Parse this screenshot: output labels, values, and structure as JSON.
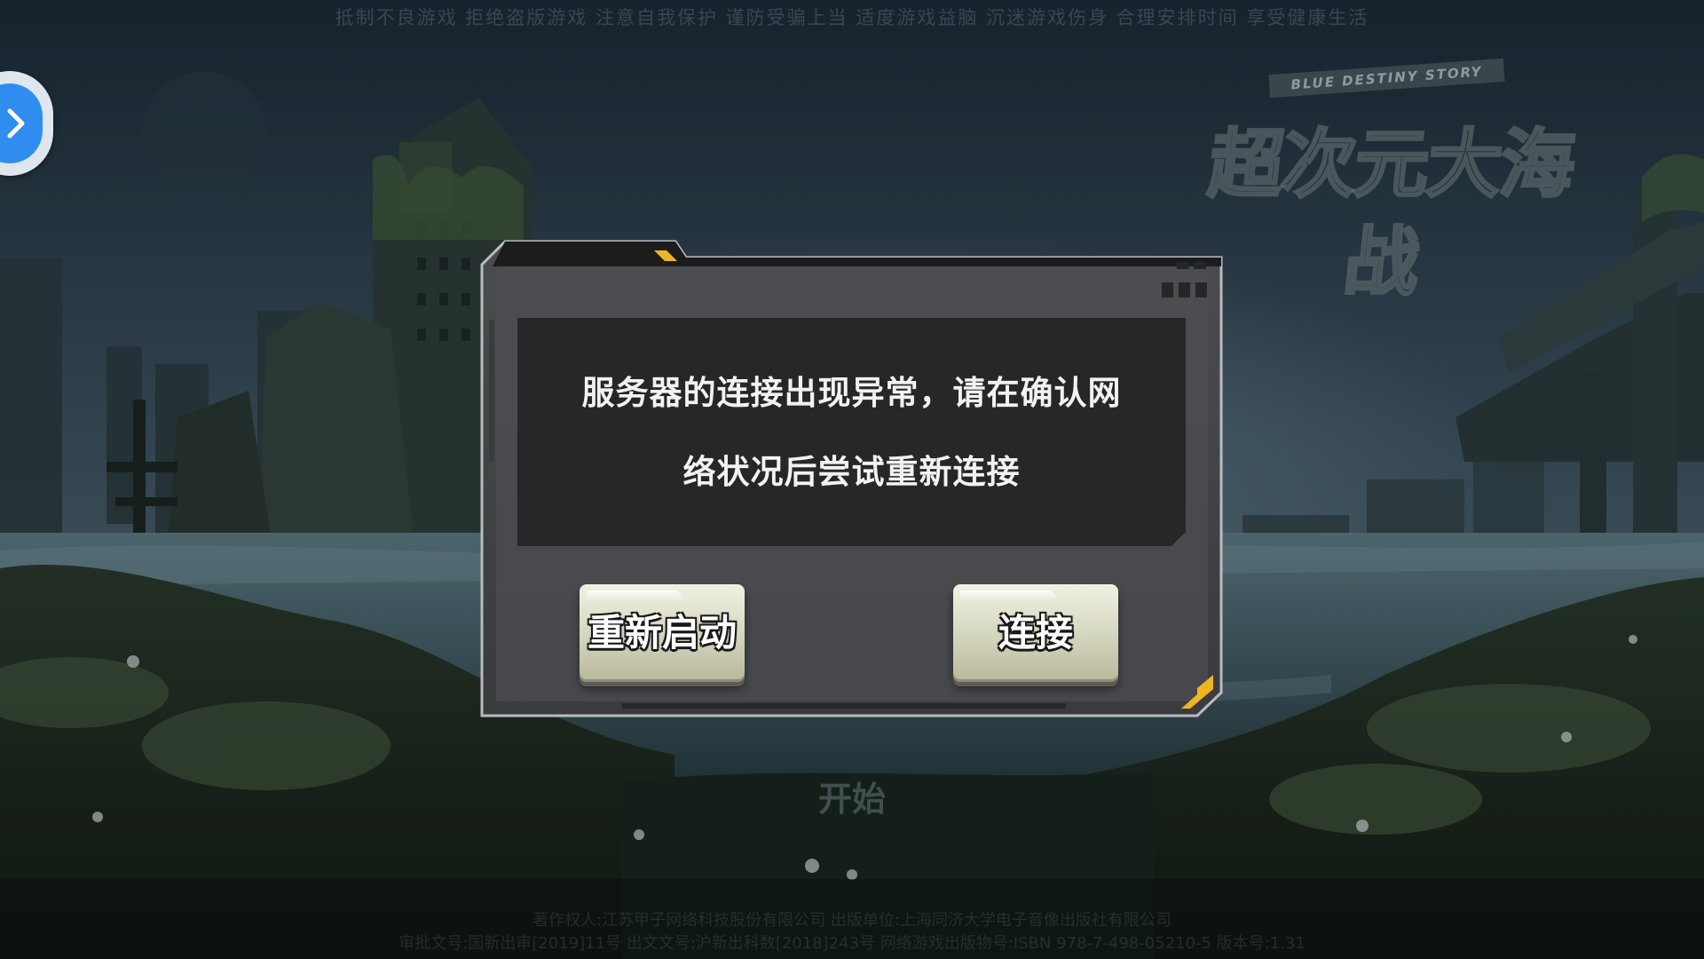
{
  "top_notice": "抵制不良游戏  拒绝盗版游戏  注意自我保护  谨防受骗上当  适度游戏益脑  沉迷游戏伤身  合理安排时间  享受健康生活",
  "logo": {
    "subtitle": "BLUE DESTINY STORY",
    "title": "超次元大海战"
  },
  "side_tab": {
    "icon": "chevron-right-icon",
    "color": "#2f8df0"
  },
  "background_start_label": "开始",
  "footer": {
    "line1": "著作权人:江苏甲子网络科技股份有限公司        出版单位:上海同济大学电子音像出版社有限公司",
    "line2": "审批文号:国新出审[2019]11号   出文文号:沪新出科数[2018]243号   网络游戏出版物号:ISBN 978-7-498-05210-5   版本号:1.31"
  },
  "dialog": {
    "message_line1": "服务器的连接出现异常，请在确认网",
    "message_line2": "络状况后尝试重新连接",
    "restart_label": "重新启动",
    "connect_label": "连接",
    "accent_color": "#f0b423"
  }
}
